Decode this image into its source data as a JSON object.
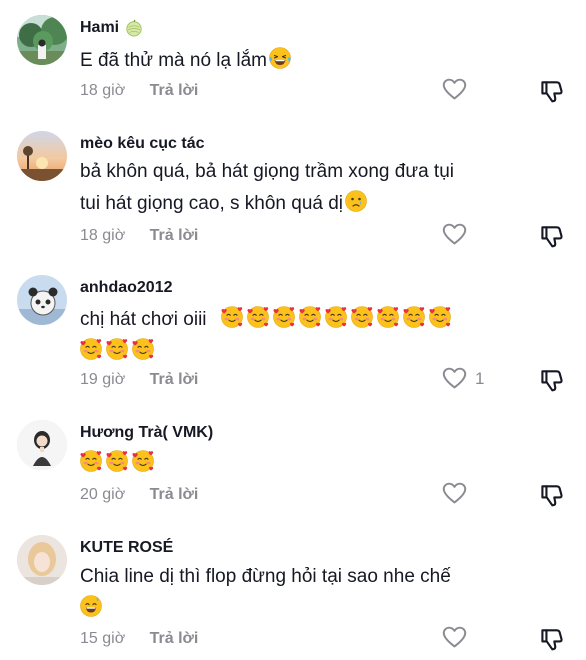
{
  "colors": {
    "text_primary": "#161823",
    "text_secondary": "#8a8b91"
  },
  "comments": [
    {
      "username": "Hami",
      "badge": "melon-emoji",
      "lines": [
        "E đã thử mà nó lạ lắm"
      ],
      "emojis": [
        "tears-of-joy-emoji"
      ],
      "time": "18 giờ",
      "reply_label": "Trả lời",
      "like_count": ""
    },
    {
      "username": "mèo kêu cục tác",
      "lines": [
        "bả khôn quá, bả hát giọng trầm xong đưa tụi",
        "tui hát giọng cao, s khôn quá dị"
      ],
      "emojis": [
        "crying-face-emoji"
      ],
      "time": "18 giờ",
      "reply_label": "Trả lời",
      "like_count": ""
    },
    {
      "username": "anhdao2012",
      "lines": [
        "chị hát chơi oiii"
      ],
      "emojis": [
        "smiling-face-with-hearts-emoji"
      ],
      "emoji_count": 12,
      "time": "19 giờ",
      "reply_label": "Trả lời",
      "like_count": "1"
    },
    {
      "username": "Hương Trà( VMK)",
      "lines": [
        ""
      ],
      "emojis": [
        "smiling-face-with-hearts-emoji"
      ],
      "emoji_count": 3,
      "time": "20 giờ",
      "reply_label": "Trả lời",
      "like_count": ""
    },
    {
      "username": "KUTE ROSÉ",
      "lines": [
        "Chia line dị thì flop đừng hỏi tại sao nhe chế"
      ],
      "emojis": [
        "grinning-sweat-emoji"
      ],
      "time": "15 giờ",
      "reply_label": "Trả lời",
      "like_count": ""
    }
  ]
}
